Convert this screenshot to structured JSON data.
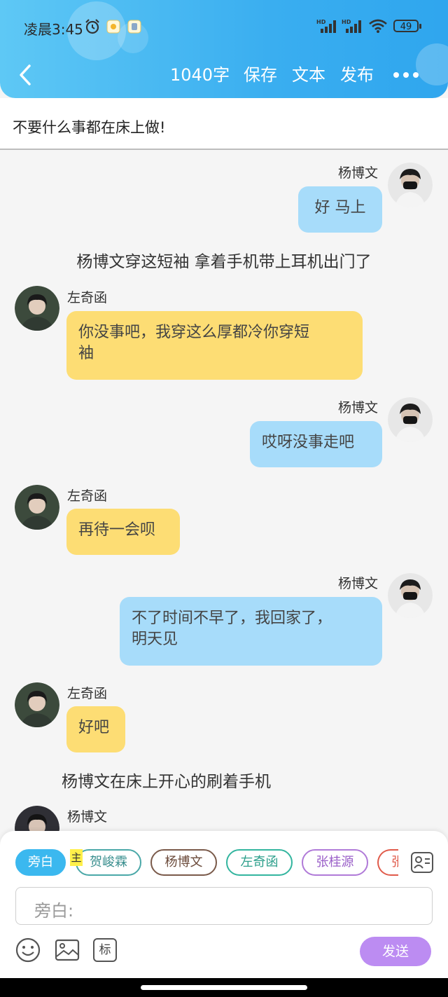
{
  "status_bar": {
    "time": "凌晨3:45",
    "battery": "49"
  },
  "toolbar": {
    "word_count": "1040字",
    "save": "保存",
    "text": "文本",
    "publish": "发布"
  },
  "title": "不要什么事都在床上做!",
  "chat": {
    "messages": [
      {
        "type": "right",
        "name": "杨博文",
        "text": "好 马上"
      },
      {
        "type": "narration",
        "text": "杨博文穿这短袖 拿着手机带上耳机出门了"
      },
      {
        "type": "left",
        "name": "左奇函",
        "text": "你没事吧，我穿这么厚都冷你穿短\n袖"
      },
      {
        "type": "right",
        "name": "杨博文",
        "text": "哎呀没事走吧"
      },
      {
        "type": "left",
        "name": "左奇函",
        "text": "再待一会呗"
      },
      {
        "type": "right",
        "name": "杨博文",
        "text": "不了时间不早了，我回家了，\n明天见"
      },
      {
        "type": "left",
        "name": "左奇函",
        "text": "好吧"
      },
      {
        "type": "narration",
        "text": "杨博文在床上开心的刷着手机"
      },
      {
        "type": "left",
        "name": "杨博文",
        "text": ""
      }
    ]
  },
  "composer": {
    "characters": [
      "旁白",
      "贺峻霖",
      "杨博文",
      "左奇函",
      "张桂源",
      "张"
    ],
    "main_badge": "主",
    "placeholder": "旁白:",
    "tag_label": "标",
    "send": "发送"
  },
  "colors": {
    "header_accent": "#3aaef0",
    "bubble_right": "#a7dcfa",
    "bubble_left": "#fddd74",
    "send_button": "#bc8cf2",
    "narration_chip": "#3bb8ef"
  }
}
